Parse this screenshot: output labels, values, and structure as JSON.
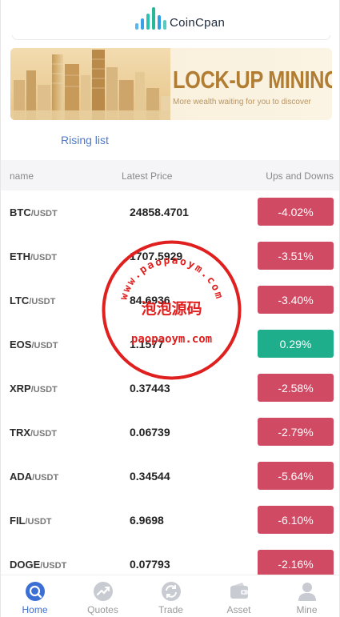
{
  "app": {
    "logo_text": "CoinCpan"
  },
  "banner": {
    "title": "LOCK-UP MINING",
    "subtitle": "More wealth waiting for you to discover"
  },
  "tabs": {
    "rising": "Rising list"
  },
  "table": {
    "headers": {
      "name": "name",
      "price": "Latest Price",
      "change": "Ups and Downs"
    },
    "rows": [
      {
        "base": "BTC",
        "quote": "/USDT",
        "price": "24858.4701",
        "change": "-4.02%",
        "direction": "down"
      },
      {
        "base": "ETH",
        "quote": "/USDT",
        "price": "1707.5929",
        "change": "-3.51%",
        "direction": "down"
      },
      {
        "base": "LTC",
        "quote": "/USDT",
        "price": "84.6936",
        "change": "-3.40%",
        "direction": "down"
      },
      {
        "base": "EOS",
        "quote": "/USDT",
        "price": "1.1577",
        "change": "0.29%",
        "direction": "up"
      },
      {
        "base": "XRP",
        "quote": "/USDT",
        "price": "0.37443",
        "change": "-2.58%",
        "direction": "down"
      },
      {
        "base": "TRX",
        "quote": "/USDT",
        "price": "0.06739",
        "change": "-2.79%",
        "direction": "down"
      },
      {
        "base": "ADA",
        "quote": "/USDT",
        "price": "0.34544",
        "change": "-5.64%",
        "direction": "down"
      },
      {
        "base": "FIL",
        "quote": "/USDT",
        "price": "6.9698",
        "change": "-6.10%",
        "direction": "down"
      },
      {
        "base": "DOGE",
        "quote": "/USDT",
        "price": "0.07793",
        "change": "-2.16%",
        "direction": "down"
      }
    ]
  },
  "colors": {
    "down": "#d14a63",
    "up": "#1fae8c",
    "accent": "#3b6fd4",
    "stamp": "#e0201f"
  },
  "watermark": {
    "line1": "www.paopaoym.com",
    "line2": "泡泡源码",
    "line3": "paopaoym.com"
  },
  "nav": {
    "items": [
      {
        "label": "Home",
        "icon": "home-icon",
        "active": true
      },
      {
        "label": "Quotes",
        "icon": "quotes-icon",
        "active": false
      },
      {
        "label": "Trade",
        "icon": "trade-icon",
        "active": false
      },
      {
        "label": "Asset",
        "icon": "wallet-icon",
        "active": false
      },
      {
        "label": "Mine",
        "icon": "user-icon",
        "active": false
      }
    ]
  }
}
